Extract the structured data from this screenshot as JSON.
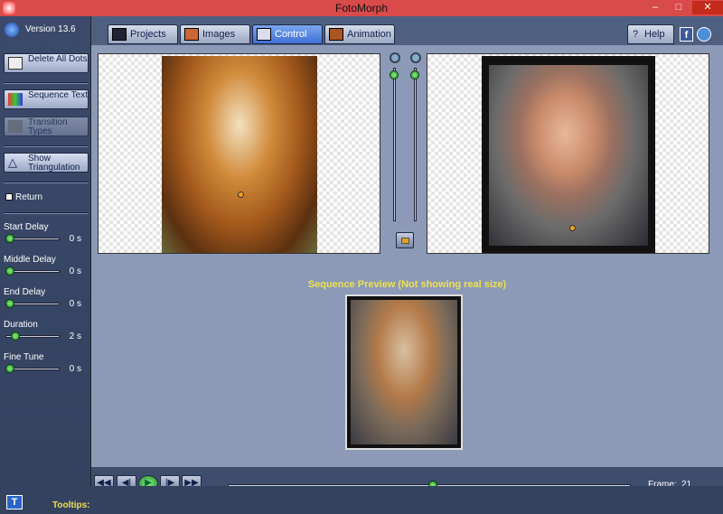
{
  "window": {
    "title": "FotoMorph",
    "min": "–",
    "max": "□",
    "close": "✕"
  },
  "version": "Version 13.6",
  "tabs": [
    {
      "label": "Projects"
    },
    {
      "label": "Images"
    },
    {
      "label": "Control"
    },
    {
      "label": "Animation"
    }
  ],
  "help": {
    "label": "Help"
  },
  "sidebar": {
    "delete_dots": "Delete All Dots",
    "sequence_text": "Sequence Text",
    "transition_types": "Transition Types",
    "show_triangulation": "Show Triangulation",
    "return_label": "Return",
    "sliders": [
      {
        "label": "Start Delay",
        "value": "0 s",
        "level": 0.02
      },
      {
        "label": "Middle Delay",
        "value": "0 s",
        "level": 0.02
      },
      {
        "label": "End Delay",
        "value": "0 s",
        "level": 0.02
      },
      {
        "label": "Duration",
        "value": "2 s",
        "level": 0.12
      },
      {
        "label": "Fine Tune",
        "value": "0 s",
        "level": 0.02
      }
    ]
  },
  "preview": {
    "caption": "Sequence Preview (Not showing real size)"
  },
  "playback": {
    "first": "◀◀",
    "prev": "◀|",
    "play": "▶",
    "next": "|▶",
    "last": "▶▶",
    "frame_label": "Frame:",
    "frame_value": "21",
    "position": 0.51
  },
  "footer": {
    "tooltips_label": "Tooltips:",
    "tooltip_icon": "T"
  },
  "colors": {
    "accent": "#3f6fd6",
    "caption": "#f0e04a",
    "title_bar": "#d94a4a"
  }
}
